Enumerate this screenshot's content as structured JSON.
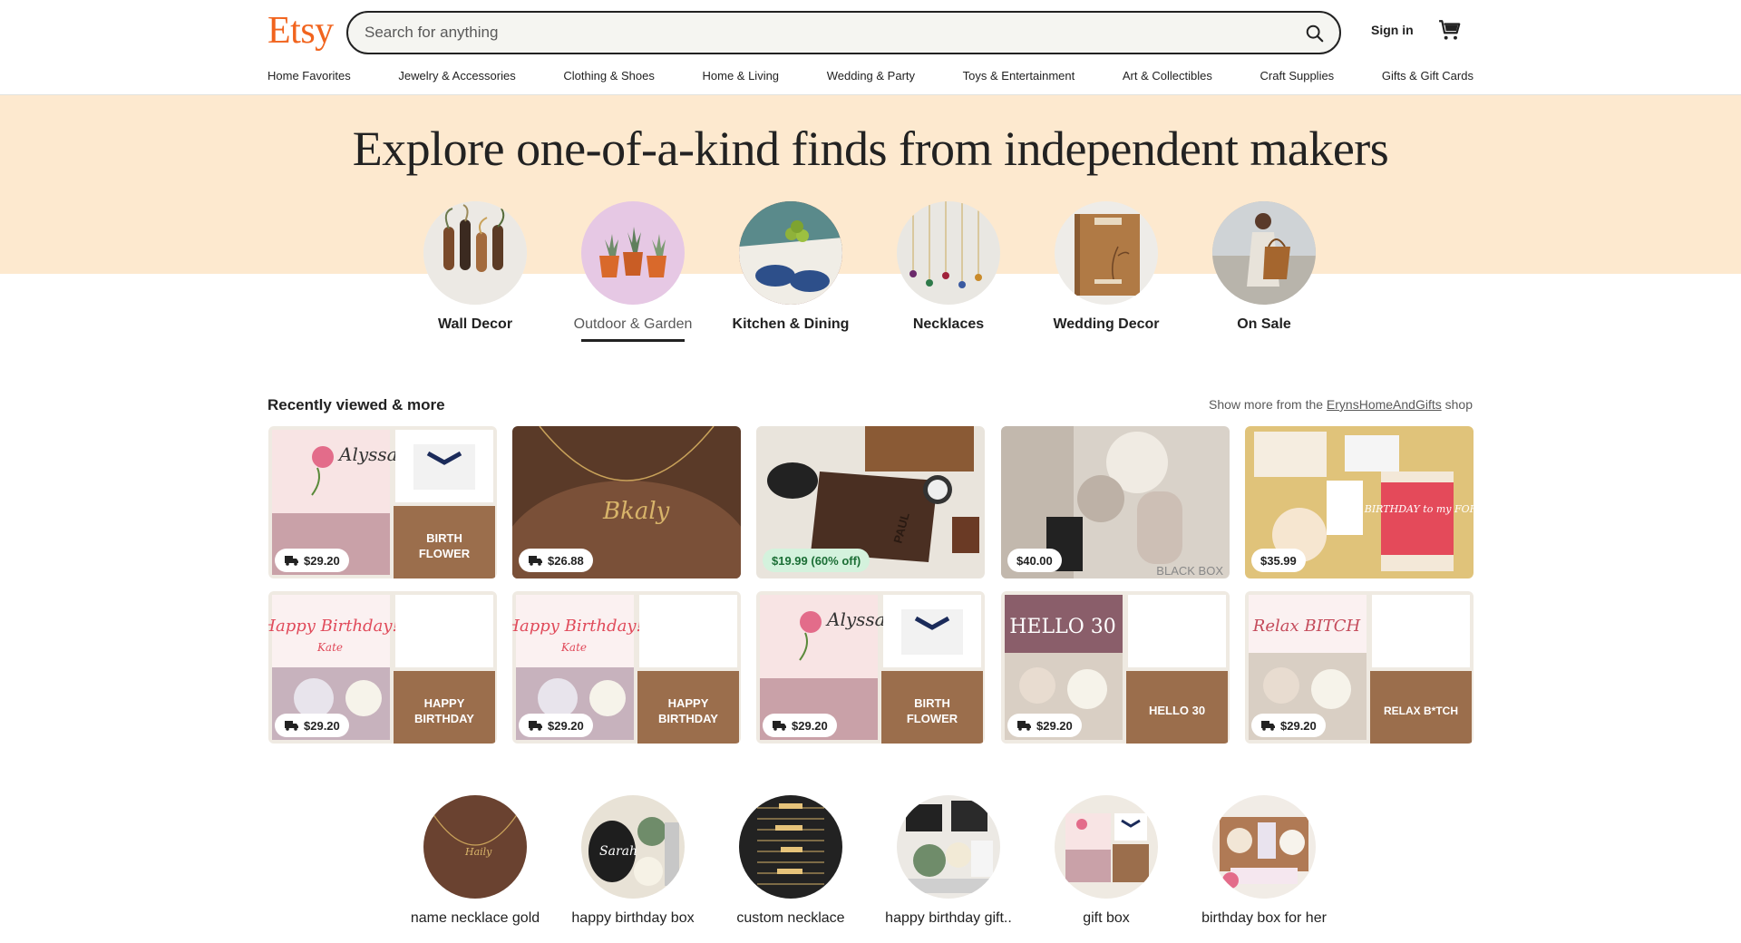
{
  "header": {
    "logo": "Etsy",
    "search_placeholder": "Search for anything",
    "signin_label": "Sign in"
  },
  "nav": [
    "Home Favorites",
    "Jewelry & Accessories",
    "Clothing & Shoes",
    "Home & Living",
    "Wedding & Party",
    "Toys & Entertainment",
    "Art & Collectibles",
    "Craft Supplies",
    "Gifts & Gift Cards"
  ],
  "hero": {
    "title": "Explore one-of-a-kind finds from independent makers",
    "categories": [
      {
        "label": "Wall Decor"
      },
      {
        "label": "Outdoor & Garden"
      },
      {
        "label": "Kitchen & Dining"
      },
      {
        "label": "Necklaces"
      },
      {
        "label": "Wedding Decor"
      },
      {
        "label": "On Sale"
      }
    ]
  },
  "recent": {
    "title": "Recently viewed & more",
    "show_more_prefix": "Show more from the ",
    "shop_name": "ErynsHomeAndGifts",
    "show_more_suffix": " shop",
    "tiles": [
      {
        "price": "$29.20",
        "text1": "BIRTH",
        "text2": "FLOWER",
        "script": "Alyssa"
      },
      {
        "price": "$26.88",
        "script": "Bkaly"
      },
      {
        "price": "$19.99 (60% off)",
        "engraving": "PAUL"
      },
      {
        "price": "$40.00",
        "corner_text": "BLACK BOX"
      },
      {
        "price": "$35.99",
        "script": "Happy BIRTHDAY to my FOREVER"
      },
      {
        "price": "$29.20",
        "text1": "HAPPY",
        "text2": "BIRTHDAY",
        "script": "Happy Birthday!",
        "name": "Kate"
      },
      {
        "price": "$29.20",
        "text1": "HAPPY",
        "text2": "BIRTHDAY",
        "script": "Happy Birthday!",
        "name": "Kate"
      },
      {
        "price": "$29.20",
        "text1": "BIRTH",
        "text2": "FLOWER",
        "script": "Alyssa"
      },
      {
        "price": "$29.20",
        "text1": "HELLO 30",
        "text2": "",
        "script": "HELLO 30"
      },
      {
        "price": "$29.20",
        "text1": "RELAX B*TCH",
        "text2": "",
        "script": "Relax BITCH"
      }
    ]
  },
  "bottom_categories": [
    {
      "label": "name necklace gold"
    },
    {
      "label": "happy birthday box"
    },
    {
      "label": "custom necklace"
    },
    {
      "label": "happy birthday gift.."
    },
    {
      "label": "gift box"
    },
    {
      "label": "birthday box for her"
    }
  ],
  "colors": {
    "brand": "#f1641e",
    "hero_bg": "#fde9cf",
    "sale_green": "#1b6e35"
  },
  "icons": {
    "search": "search-icon",
    "cart": "cart-icon",
    "truck": "truck-icon"
  }
}
